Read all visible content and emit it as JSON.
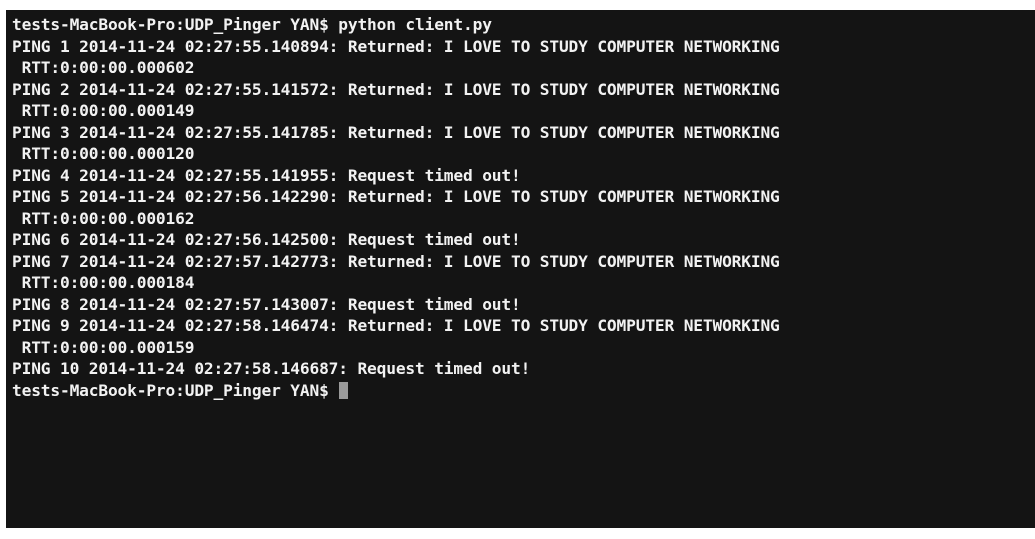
{
  "terminal": {
    "lines": [
      "tests-MacBook-Pro:UDP_Pinger YAN$ python client.py",
      "PING 1 2014-11-24 02:27:55.140894: Returned: I LOVE TO STUDY COMPUTER NETWORKING",
      " RTT:0:00:00.000602",
      "PING 2 2014-11-24 02:27:55.141572: Returned: I LOVE TO STUDY COMPUTER NETWORKING",
      " RTT:0:00:00.000149",
      "PING 3 2014-11-24 02:27:55.141785: Returned: I LOVE TO STUDY COMPUTER NETWORKING",
      " RTT:0:00:00.000120",
      "PING 4 2014-11-24 02:27:55.141955: Request timed out!",
      "PING 5 2014-11-24 02:27:56.142290: Returned: I LOVE TO STUDY COMPUTER NETWORKING",
      " RTT:0:00:00.000162",
      "PING 6 2014-11-24 02:27:56.142500: Request timed out!",
      "PING 7 2014-11-24 02:27:57.142773: Returned: I LOVE TO STUDY COMPUTER NETWORKING",
      " RTT:0:00:00.000184",
      "PING 8 2014-11-24 02:27:57.143007: Request timed out!",
      "PING 9 2014-11-24 02:27:58.146474: Returned: I LOVE TO STUDY COMPUTER NETWORKING",
      " RTT:0:00:00.000159",
      "PING 10 2014-11-24 02:27:58.146687: Request timed out!"
    ],
    "prompt": "tests-MacBook-Pro:UDP_Pinger YAN$ ",
    "colors": {
      "background": "#141414",
      "text": "#f2f2f2",
      "cursor": "#9a9a9a"
    }
  }
}
